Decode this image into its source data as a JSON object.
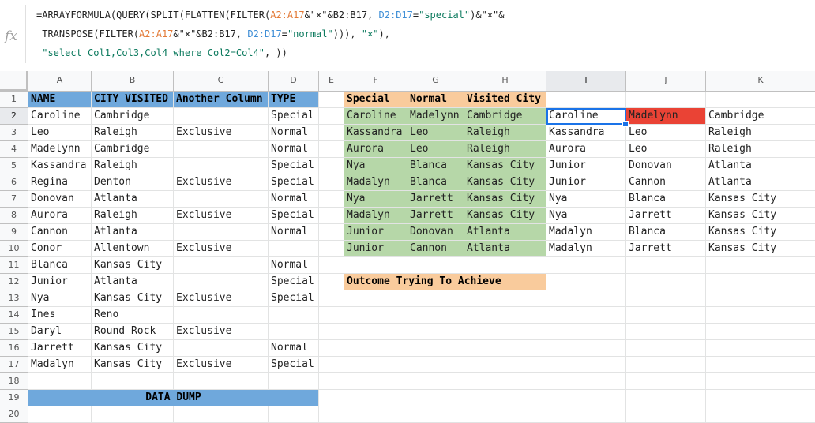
{
  "formula_bar": {
    "fx_label": "fx",
    "line1": {
      "p1": "=ARRAYFORMULA(QUERY(SPLIT(FLATTEN(FILTER(",
      "r1": "A2:A17",
      "p2": "&\"×\"&",
      "r2": "B2:B17",
      "p3": ", ",
      "r3": "D2:D17",
      "p4": "=",
      "s1": "\"special\"",
      "p5": ")&\"×\"&"
    },
    "line2": {
      "p1": " TRANSPOSE(FILTER(",
      "r1": "A2:A17",
      "p2": "&\"×\"&",
      "r2": "B2:B17",
      "p3": ", ",
      "r3": "D2:D17",
      "p4": "=",
      "s1": "\"normal\"",
      "p5": "))), ",
      "s2": "\"×\"",
      "p6": "),"
    },
    "line3": {
      "s1": " \"select Col1,Col3,Col4 where Col2=Col4\"",
      "p1": ", ))"
    }
  },
  "columns": [
    "A",
    "B",
    "C",
    "D",
    "E",
    "F",
    "G",
    "H",
    "I",
    "J",
    "K"
  ],
  "rows": [
    "1",
    "2",
    "3",
    "4",
    "5",
    "6",
    "7",
    "8",
    "9",
    "10",
    "11",
    "12",
    "13",
    "14",
    "15",
    "16",
    "17",
    "18",
    "19",
    "20"
  ],
  "cells": {
    "A1": "NAME",
    "B1": "CITY VISITED",
    "C1": "Another Column",
    "D1": "TYPE",
    "F1": "Special",
    "G1": "Normal",
    "H1": "Visited City",
    "A2": "Caroline",
    "B2": "Cambridge",
    "D2": "Special",
    "F2": "Caroline",
    "G2": "Madelynn",
    "H2": "Cambridge",
    "I2": "Caroline",
    "J2": "Madelynn",
    "K2": "Cambridge",
    "A3": "Leo",
    "B3": "Raleigh",
    "C3": "Exclusive",
    "D3": "Normal",
    "F3": "Kassandra",
    "G3": "Leo",
    "H3": "Raleigh",
    "I3": "Kassandra",
    "J3": "Leo",
    "K3": "Raleigh",
    "A4": "Madelynn",
    "B4": "Cambridge",
    "D4": "Normal",
    "F4": "Aurora",
    "G4": "Leo",
    "H4": "Raleigh",
    "I4": "Aurora",
    "J4": "Leo",
    "K4": "Raleigh",
    "A5": "Kassandra",
    "B5": "Raleigh",
    "D5": "Special",
    "F5": "Nya",
    "G5": "Blanca",
    "H5": "Kansas City",
    "I5": "Junior",
    "J5": "Donovan",
    "K5": "Atlanta",
    "A6": "Regina",
    "B6": "Denton",
    "C6": "Exclusive",
    "D6": "Special",
    "F6": "Madalyn",
    "G6": "Blanca",
    "H6": "Kansas City",
    "I6": "Junior",
    "J6": "Cannon",
    "K6": "Atlanta",
    "A7": "Donovan",
    "B7": "Atlanta",
    "D7": "Normal",
    "F7": "Nya",
    "G7": "Jarrett",
    "H7": "Kansas City",
    "I7": "Nya",
    "J7": "Blanca",
    "K7": "Kansas City",
    "A8": "Aurora",
    "B8": "Raleigh",
    "C8": "Exclusive",
    "D8": "Special",
    "F8": "Madalyn",
    "G8": "Jarrett",
    "H8": "Kansas City",
    "I8": "Nya",
    "J8": "Jarrett",
    "K8": "Kansas City",
    "A9": "Cannon",
    "B9": "Atlanta",
    "D9": "Normal",
    "F9": "Junior",
    "G9": "Donovan",
    "H9": "Atlanta",
    "I9": "Madalyn",
    "J9": "Blanca",
    "K9": "Kansas City",
    "A10": "Conor",
    "B10": "Allentown",
    "C10": "Exclusive",
    "F10": "Junior",
    "G10": "Cannon",
    "H10": "Atlanta",
    "I10": "Madalyn",
    "J10": "Jarrett",
    "K10": "Kansas City",
    "A11": "Blanca",
    "B11": "Kansas City",
    "D11": "Normal",
    "A12": "Junior",
    "B12": "Atlanta",
    "D12": "Special",
    "F12": "Outcome Trying To Achieve",
    "A13": "Nya",
    "B13": "Kansas City",
    "C13": "Exclusive",
    "D13": "Special",
    "A14": "Ines",
    "B14": "Reno",
    "A15": "Daryl",
    "B15": "Round Rock",
    "C15": "Exclusive",
    "A16": "Jarrett",
    "B16": "Kansas City",
    "D16": "Normal",
    "A17": "Madalyn",
    "B17": "Kansas City",
    "C17": "Exclusive",
    "D17": "Special",
    "A19": "DATA DUMP"
  },
  "colors": {
    "header_blue": "#6fa8dc",
    "header_orange": "#f9cb9c",
    "result_green": "#b6d7a8",
    "highlight_red": "#ea4335",
    "selection_blue": "#1a73e8"
  },
  "selected_cell": "I2"
}
